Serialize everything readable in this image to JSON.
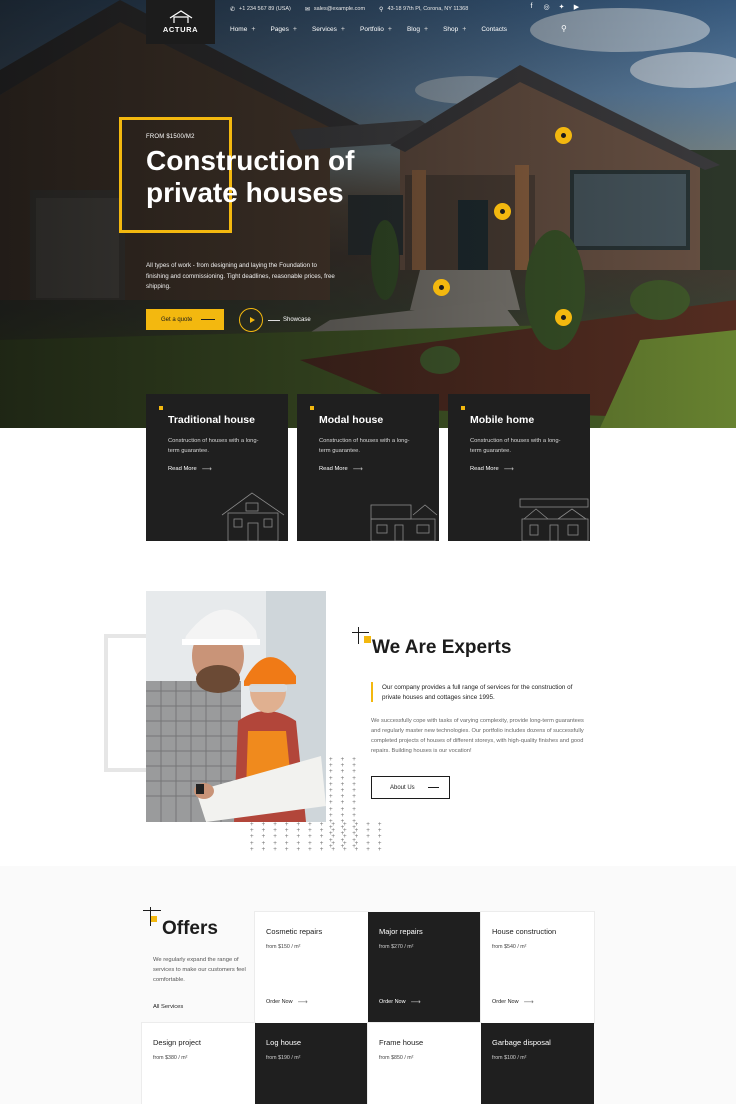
{
  "brand": {
    "name": "ACTURA",
    "accent": "#f3b80f",
    "dark": "#1f1f1f"
  },
  "topbar": {
    "phone": "+1 234 567 89 (USA)",
    "email": "sales@example.com",
    "address": "43-18 97th Pl, Corona, NY 11368",
    "socials": [
      "facebook-icon",
      "instagram-icon",
      "twitter-icon",
      "youtube-icon"
    ]
  },
  "nav": {
    "items": [
      "Home",
      "Pages",
      "Services",
      "Portfolio",
      "Blog",
      "Shop",
      "Contacts"
    ],
    "search_icon": "search-icon"
  },
  "hero": {
    "pretitle": "FROM $1500/M2",
    "title_line1": "Construction of",
    "title_line2": "private houses",
    "description": "All types of work - from designing and laying the Foundation to finishing and commissioning. Tight deadlines, reasonable prices, free shipping.",
    "cta_label": "Get a quote",
    "showcase_label": "Showcase"
  },
  "house_cards": [
    {
      "title": "Traditional house",
      "description": "Construction of houses with a long-term guarantee.",
      "link": "Read More"
    },
    {
      "title": "Modal house",
      "description": "Construction of houses with a long-term guarantee.",
      "link": "Read More"
    },
    {
      "title": "Mobile home",
      "description": "Construction of houses with a long-term guarantee.",
      "link": "Read More"
    }
  ],
  "experts": {
    "title": "We Are Experts",
    "lead": "Our company provides a full range of services for the construction of private houses and cottages since 1995.",
    "body": "We successfully cope with tasks of varying complexity, provide long-term guarantees and regularly master new technologies. Our portfolio includes dozens of successfully completed projects of houses of different storeys, with high-quality finishes and good repairs. Building houses is our vocation!",
    "button_label": "About Us"
  },
  "offers": {
    "title": "Offers",
    "description": "We regularly expand the range of services to make our customers feel comfortable.",
    "all_link": "All Services",
    "order_label": "Order Now",
    "items": [
      {
        "title": "Cosmetic repairs",
        "price": "from $150 / m²"
      },
      {
        "title": "Major repairs",
        "price": "from $270 / m²"
      },
      {
        "title": "House construction",
        "price": "from $540 / m²"
      },
      {
        "title": "Design project",
        "price": "from $380 / m²"
      },
      {
        "title": "Log house",
        "price": "from $190 / m²"
      },
      {
        "title": "Frame house",
        "price": "from $850 / m²"
      },
      {
        "title": "Garbage disposal",
        "price": "from $100 / m²"
      }
    ]
  }
}
